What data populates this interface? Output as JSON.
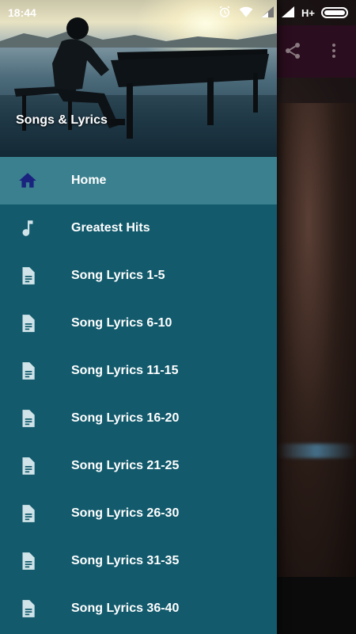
{
  "status_bar": {
    "time": "18:44",
    "network": "H+",
    "battery_level": 1.0
  },
  "drawer": {
    "header_title": "Songs & Lyrics",
    "items": [
      {
        "label": "Home",
        "icon": "home-icon",
        "active": true
      },
      {
        "label": "Greatest Hits",
        "icon": "music-note-icon",
        "active": false
      },
      {
        "label": "Song Lyrics 1-5",
        "icon": "document-icon",
        "active": false
      },
      {
        "label": "Song Lyrics 6-10",
        "icon": "document-icon",
        "active": false
      },
      {
        "label": "Song Lyrics 11-15",
        "icon": "document-icon",
        "active": false
      },
      {
        "label": "Song Lyrics 16-20",
        "icon": "document-icon",
        "active": false
      },
      {
        "label": "Song Lyrics 21-25",
        "icon": "document-icon",
        "active": false
      },
      {
        "label": "Song Lyrics 26-30",
        "icon": "document-icon",
        "active": false
      },
      {
        "label": "Song Lyrics 31-35",
        "icon": "document-icon",
        "active": false
      },
      {
        "label": "Song Lyrics 36-40",
        "icon": "document-icon",
        "active": false
      }
    ]
  },
  "toolbar": {
    "icons": [
      "share-icon",
      "more-vert-icon"
    ]
  },
  "colors": {
    "drawer_bg": "#125a6c",
    "drawer_active": "#3a808f",
    "home_icon": "#1a237e",
    "item_icon": "#cfe3e8"
  }
}
